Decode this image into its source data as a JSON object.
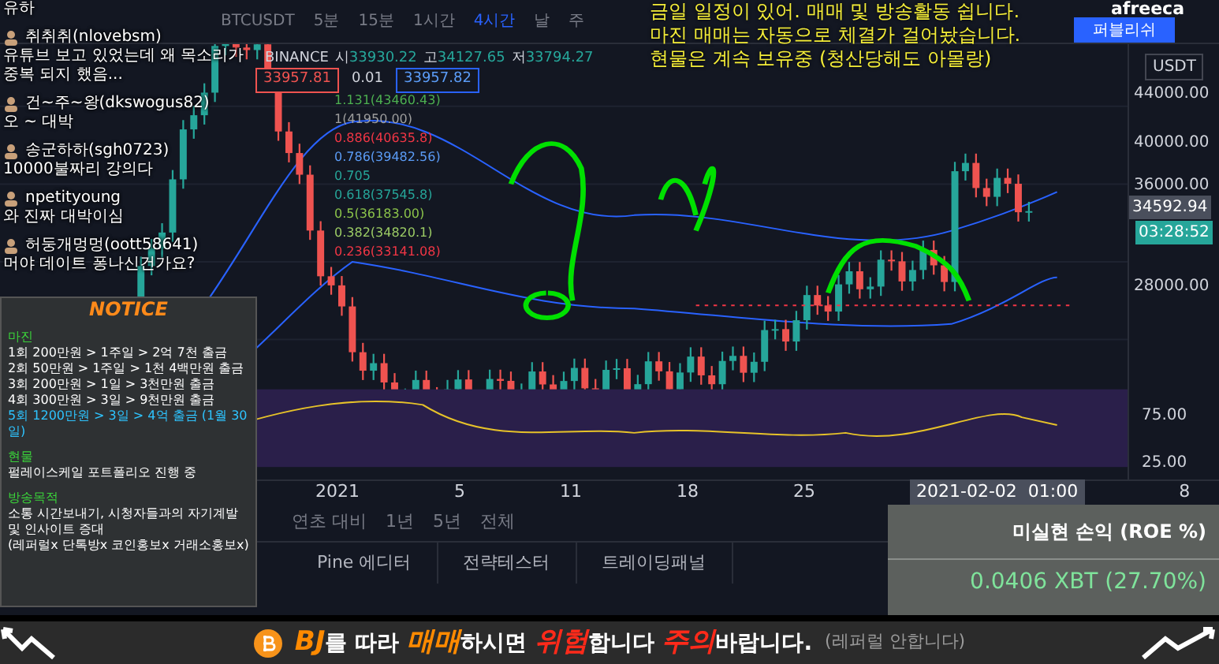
{
  "toolbar": {
    "symbol": "BTCUSDT",
    "intervals": [
      {
        "label": "5분",
        "selected": false
      },
      {
        "label": "15분",
        "selected": false
      },
      {
        "label": "1시간",
        "selected": false
      },
      {
        "label": "4시간",
        "selected": true
      },
      {
        "label": "날",
        "selected": false
      },
      {
        "label": "주",
        "selected": false
      }
    ],
    "publish_button": "퍼블리쉬"
  },
  "legend": {
    "exchange": "BINANCE",
    "ohlc": [
      {
        "label": "시",
        "value": "33930.22"
      },
      {
        "label": "고",
        "value": "34127.65"
      },
      {
        "label": "저",
        "value": "33794.27"
      }
    ]
  },
  "order_prices": {
    "sell": "33957.81",
    "spread": "0.01",
    "buy": "33957.82"
  },
  "fib_levels": [
    {
      "label": "1.131(43460.43)",
      "color": "#4caf50"
    },
    {
      "label": "1(41950.00)",
      "color": "#9e9e9e"
    },
    {
      "label": "0.886(40635.8)",
      "color": "#f23645"
    },
    {
      "label": "0.786(39482.56)",
      "color": "#5b9cf6"
    },
    {
      "label": "0.705",
      "color": "#26a69a"
    },
    {
      "label": "0.618(37545.8)",
      "color": "#26a69a"
    },
    {
      "label": "0.5(36183.00)",
      "color": "#8bc34a"
    },
    {
      "label": "0.382(34820.1)",
      "color": "#9ccc65"
    },
    {
      "label": "0.236(33141.08)",
      "color": "#f23645"
    }
  ],
  "price_axis": {
    "currency": "USDT",
    "ticks": [
      "44000.00",
      "40000.00",
      "36000.00",
      "28000.00"
    ],
    "last_price": "34592.94",
    "countdown": "03:28:52",
    "rsi_ticks": [
      "75.00",
      "25.00"
    ]
  },
  "time_axis": {
    "ticks": [
      "2021",
      "5",
      "11",
      "18",
      "25",
      "8"
    ],
    "cursor": "2021-02-02  01:00"
  },
  "range_buttons": [
    "연초 대비",
    "1년",
    "5년",
    "전체"
  ],
  "bottom_tabs": [
    "Pine 에디터",
    "전략테스터",
    "트레이딩패널"
  ],
  "pnl": {
    "title": "미실현 손익 (ROE %)",
    "value": "0.0406 XBT (27.70%)"
  },
  "logo": "afreeca",
  "stream_notice": [
    "금일 일정이 있어. 매매 및 방송활동 쉽니다.",
    "마진 매매는 자동으로 체결가 걸어놨습니다.",
    "현물은 계속 보유중 (청산당해도 아몰랑)"
  ],
  "chat": {
    "tail": "유하",
    "messages": [
      {
        "user": "취취취(nlovebsm)",
        "text": "유튜브 보고 있었는데 왜 목소리가 중복 되지 했음..."
      },
      {
        "user": "건~주~왕(dkswogus82)",
        "text": "오 ~ 대박"
      },
      {
        "user": "송군하하(sgh0723)",
        "text": "10000불짜리 강의다"
      },
      {
        "user": "npetityoung",
        "text": "와 진짜 대박이심"
      },
      {
        "user": "허둥개멍멍(oott58641)",
        "text": "머야 데이트 퐁나신건가요?"
      }
    ]
  },
  "notice": {
    "title": "NOTICE",
    "sections": [
      {
        "heading": "마진",
        "lines": [
          {
            "text": "1회 200만원 > 1주일 > 2억 7천 출금",
            "highlight": false
          },
          {
            "text": "2회 50만원 > 1주일 > 1천 4백만원 출금",
            "highlight": false
          },
          {
            "text": "3회 200만원 > 1일 > 3천만원 출금",
            "highlight": false
          },
          {
            "text": "4회 300만원 > 3일 > 9천만원 출금",
            "highlight": false
          },
          {
            "text": "5회 1200만원 > 3일 > 4억 출금 (1월 30일)",
            "highlight": true
          }
        ]
      },
      {
        "heading": "현물",
        "lines": [
          {
            "text": "펄레이스케일 포트폴리오 진행 중",
            "highlight": false
          }
        ]
      },
      {
        "heading": "방송목적",
        "lines": [
          {
            "text": "소통 시간보내기, 시청자들과의 자기계발 및 인사이트 증대",
            "highlight": false
          },
          {
            "text": "(레퍼럴x 단톡방x 코인홍보x 거래소홍보x)",
            "highlight": false
          }
        ]
      }
    ]
  },
  "banner": {
    "parts": [
      {
        "text": "BJ",
        "kind": "orange"
      },
      {
        "text": "를 따라 ",
        "kind": "plain"
      },
      {
        "text": "매매",
        "kind": "orange"
      },
      {
        "text": "하시면 ",
        "kind": "plain"
      },
      {
        "text": "위험",
        "kind": "red"
      },
      {
        "text": "합니다 ",
        "kind": "plain"
      },
      {
        "text": "주의",
        "kind": "red"
      },
      {
        "text": "바랍니다.",
        "kind": "plain"
      }
    ],
    "note": "(레퍼럴 안합니다)"
  }
}
